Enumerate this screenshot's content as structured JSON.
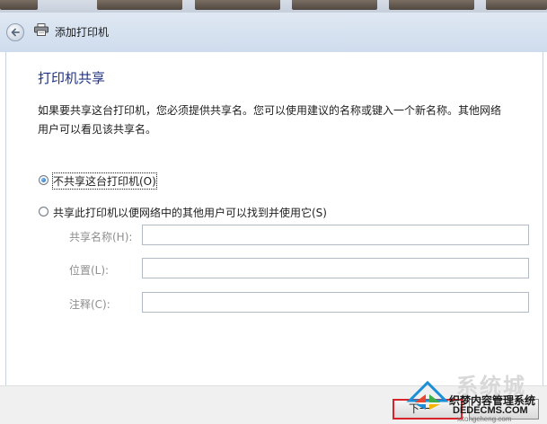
{
  "header": {
    "title": "添加打印机"
  },
  "main": {
    "page_title": "打印机共享",
    "description": "如果要共享这台打印机，您必须提供共享名。您可以使用建议的名称或键入一个新名称。其他网络用户可以看见该共享名。",
    "options": [
      {
        "label": "不共享这台打印机(O)",
        "selected": true
      },
      {
        "label": "共享此打印机以便网络中的其他用户可以找到并使用它(S)",
        "selected": false
      }
    ],
    "fields": [
      {
        "label": "共享名称(H):",
        "value": ""
      },
      {
        "label": "位置(L):",
        "value": ""
      },
      {
        "label": "注释(C):",
        "value": ""
      }
    ]
  },
  "footer": {
    "next_label": "下一"
  },
  "watermark": {
    "text_main": "系统城",
    "text_sub": "织梦内容管理系统",
    "text_domain": "DEDECMS.COM",
    "text_url": "xitongcheng.com"
  },
  "colors": {
    "title_blue": "#1e3287",
    "highlight_red": "#d8232a",
    "header_bg": "#d5e1ef"
  }
}
